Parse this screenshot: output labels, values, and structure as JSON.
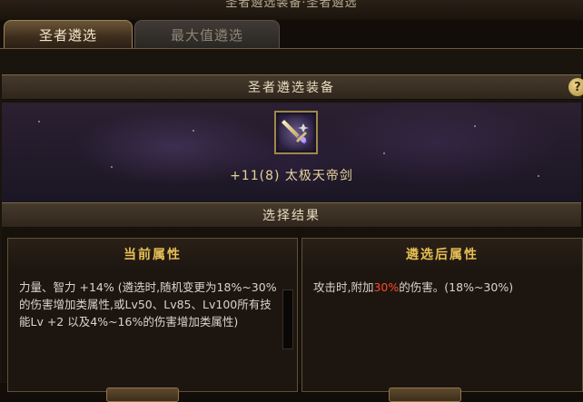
{
  "header": {
    "title": "圣者遴选装备·圣者遴选"
  },
  "tabs": [
    {
      "label": "圣者遴选",
      "active": true
    },
    {
      "label": "最大值遴选",
      "active": false
    }
  ],
  "equipment_section": {
    "title": "圣者遴选装备",
    "help_label": "?",
    "item": {
      "name": "+11(8) 太极天帝剑",
      "icon": "sword-icon"
    }
  },
  "result_section": {
    "title": "选择结果"
  },
  "current_attributes": {
    "title": "当前属性",
    "description": "力量、智力 +14% (遴选时,随机变更为18%~30%的伤害增加类属性,或Lv50、Lv85、Lv100所有技能Lv +2 以及4%~16%的伤害增加类属性)"
  },
  "selected_attributes": {
    "title": "遴选后属性",
    "desc_before": "攻击时,附加",
    "desc_highlight": "30%",
    "desc_after": "的伤害。(18%~30%)"
  },
  "colors": {
    "accent_gold": "#e8bf55",
    "highlight_red": "#ff4a2e",
    "item_name": "#e6d39a"
  }
}
